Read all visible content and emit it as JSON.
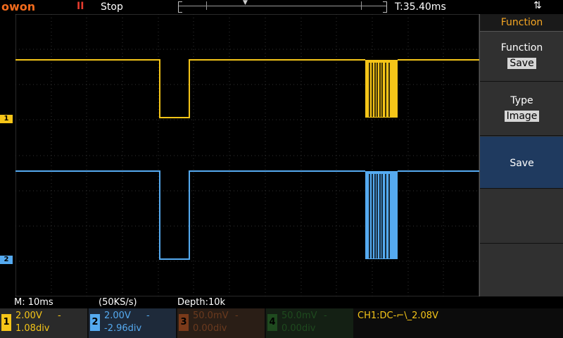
{
  "header": {
    "brand": "owon",
    "run_icon": "II",
    "run_state": "Stop",
    "trigger_time": "T:35.40ms",
    "usb_icon": "usb-icon"
  },
  "panel": {
    "title": "Function",
    "items": [
      {
        "label": "Function",
        "value": "Save"
      },
      {
        "label": "Type",
        "value": "Image"
      },
      {
        "label": "Save",
        "value": ""
      },
      {
        "label": "",
        "value": ""
      },
      {
        "label": "",
        "value": ""
      }
    ]
  },
  "status": {
    "timebase": "M: 10ms",
    "sample_rate": "(50KS/s)",
    "depth": "Depth:10k"
  },
  "channels": [
    {
      "num": "1",
      "volts": "2.00V",
      "coupling": "-",
      "offset": "1.08div",
      "color": "#f5c518",
      "bg": "#2a2a2a",
      "dim": false
    },
    {
      "num": "2",
      "volts": "2.00V",
      "coupling": "-",
      "offset": "-2.96div",
      "color": "#55aaf0",
      "bg": "#1e2a3a",
      "dim": false
    },
    {
      "num": "3",
      "volts": "50.0mV",
      "coupling": "-",
      "offset": "0.00div",
      "color": "#7a3a1a",
      "bg": "#2a1e16",
      "dim": true
    },
    {
      "num": "4",
      "volts": "50.0mV",
      "coupling": "-",
      "offset": "0.00div",
      "color": "#1f4a1f",
      "bg": "#142014",
      "dim": true
    }
  ],
  "trigger": {
    "text_left": "CH1:DC-",
    "edge_icon": "falling-edge-icon",
    "text_right": "2.08V"
  },
  "waveforms": {
    "ch1_color": "#f5c518",
    "ch2_color": "#55aaf0"
  },
  "markers": {
    "ch1": "1",
    "ch2": "2",
    "trigger": "T"
  }
}
